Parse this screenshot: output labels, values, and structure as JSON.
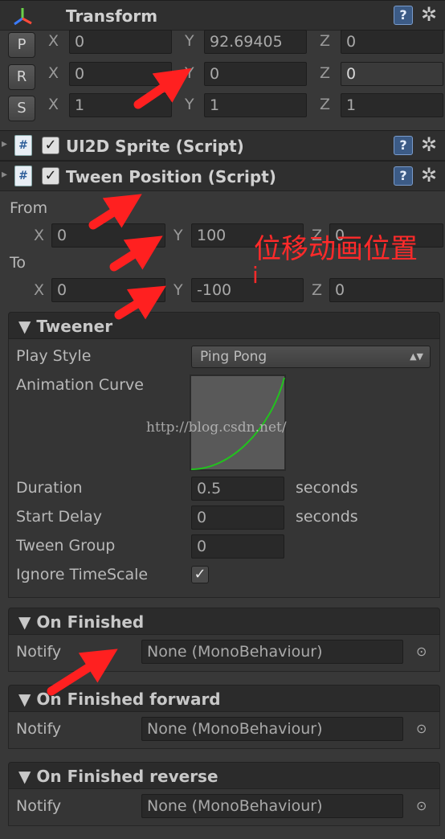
{
  "transform": {
    "title": "Transform",
    "position": {
      "label": "P",
      "x": "0",
      "y": "92.69405",
      "z": "0"
    },
    "rotation": {
      "label": "R",
      "x": "0",
      "y": "0",
      "z": "0"
    },
    "scale": {
      "label": "S",
      "x": "1",
      "y": "1",
      "z": "1"
    }
  },
  "axes": {
    "x": "X",
    "y": "Y",
    "z": "Z"
  },
  "sprite_component": {
    "title": "UI2D Sprite (Script)"
  },
  "tween_component": {
    "title": "Tween Position (Script)",
    "from_label": "From",
    "to_label": "To",
    "from": {
      "x": "0",
      "y": "100",
      "z": "0"
    },
    "to": {
      "x": "0",
      "y": "-100",
      "z": "0"
    }
  },
  "tweener": {
    "title": "Tweener",
    "play_style_label": "Play Style",
    "play_style_value": "Ping Pong",
    "curve_label": "Animation Curve",
    "duration_label": "Duration",
    "duration_value": "0.5",
    "duration_unit": "seconds",
    "start_delay_label": "Start Delay",
    "start_delay_value": "0",
    "start_delay_unit": "seconds",
    "tween_group_label": "Tween Group",
    "tween_group_value": "0",
    "ignore_timescale_label": "Ignore TimeScale",
    "ignore_timescale": true
  },
  "events": [
    {
      "title": "On Finished",
      "notify_label": "Notify",
      "value": "None (MonoBehaviour)"
    },
    {
      "title": "On Finished forward",
      "notify_label": "Notify",
      "value": "None (MonoBehaviour)"
    },
    {
      "title": "On Finished reverse",
      "notify_label": "Notify",
      "value": "None (MonoBehaviour)"
    }
  ],
  "glyphs": {
    "triangle": "▼",
    "help": "?",
    "gear": "✲",
    "check": "✓",
    "script": "#",
    "picker": "⊙",
    "updown": "▲▼",
    "expand": "▸"
  },
  "watermark": "http://blog.csdn.net/",
  "annotation": {
    "line1": "位移动画位置",
    "line2": "i"
  },
  "colors": {
    "arrow": "#ff2020",
    "curve": "#22c21e",
    "annotation": "#ff2a2a"
  }
}
